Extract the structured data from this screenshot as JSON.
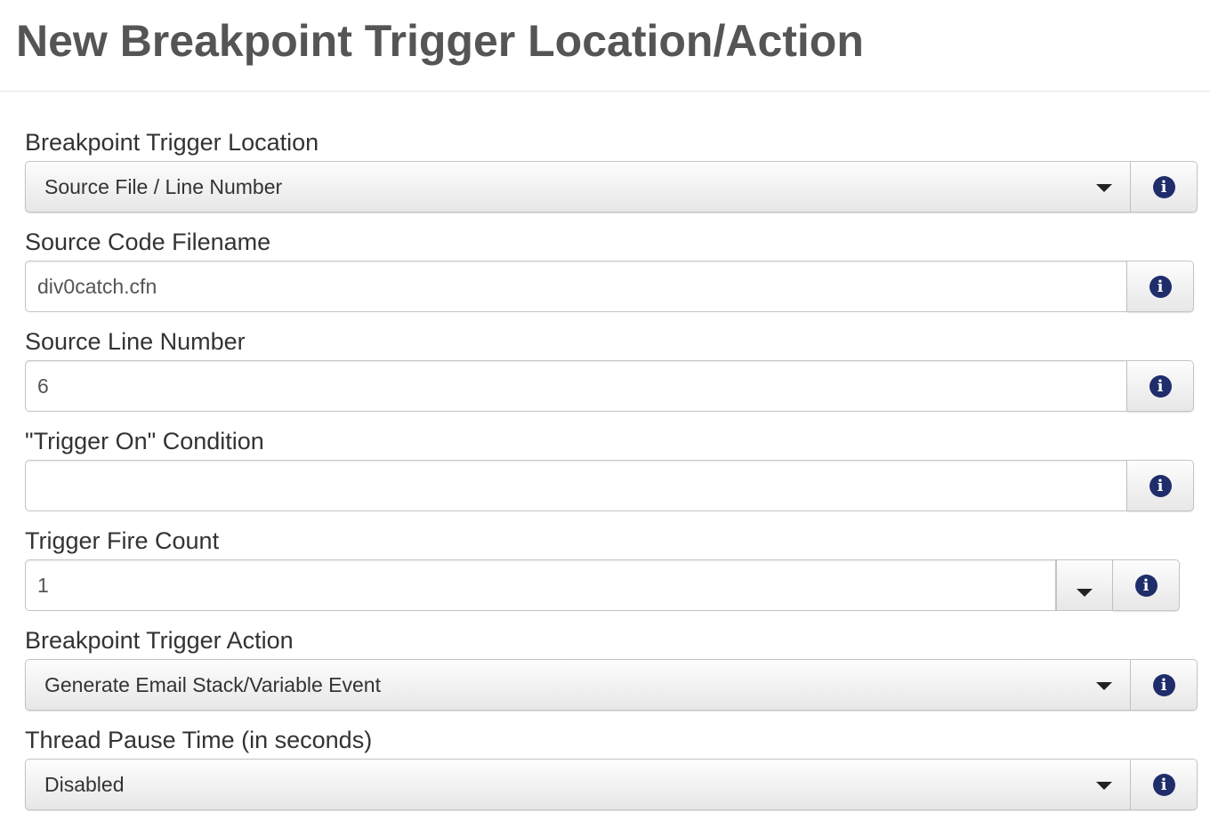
{
  "header": {
    "title": "New Breakpoint Trigger Location/Action"
  },
  "fields": {
    "trigger_location": {
      "label": "Breakpoint Trigger Location",
      "value": "Source File / Line Number",
      "info_icon": "info-icon"
    },
    "source_filename": {
      "label": "Source Code Filename",
      "value": "div0catch.cfn",
      "info_icon": "info-icon"
    },
    "source_line": {
      "label": "Source Line Number",
      "value": "6",
      "info_icon": "info-icon"
    },
    "trigger_condition": {
      "label": "\"Trigger On\" Condition",
      "value": "",
      "info_icon": "info-icon"
    },
    "fire_count": {
      "label": "Trigger Fire Count",
      "value": "1",
      "info_icon": "info-icon"
    },
    "trigger_action": {
      "label": "Breakpoint Trigger Action",
      "value": "Generate Email Stack/Variable Event",
      "info_icon": "info-icon"
    },
    "pause_time": {
      "label": "Thread Pause Time (in seconds)",
      "value": "Disabled",
      "info_icon": "info-icon"
    }
  },
  "info_glyph": "i",
  "colors": {
    "title": "#555555",
    "info_icon": "#1f2d6b",
    "border": "#c4c4c4"
  }
}
